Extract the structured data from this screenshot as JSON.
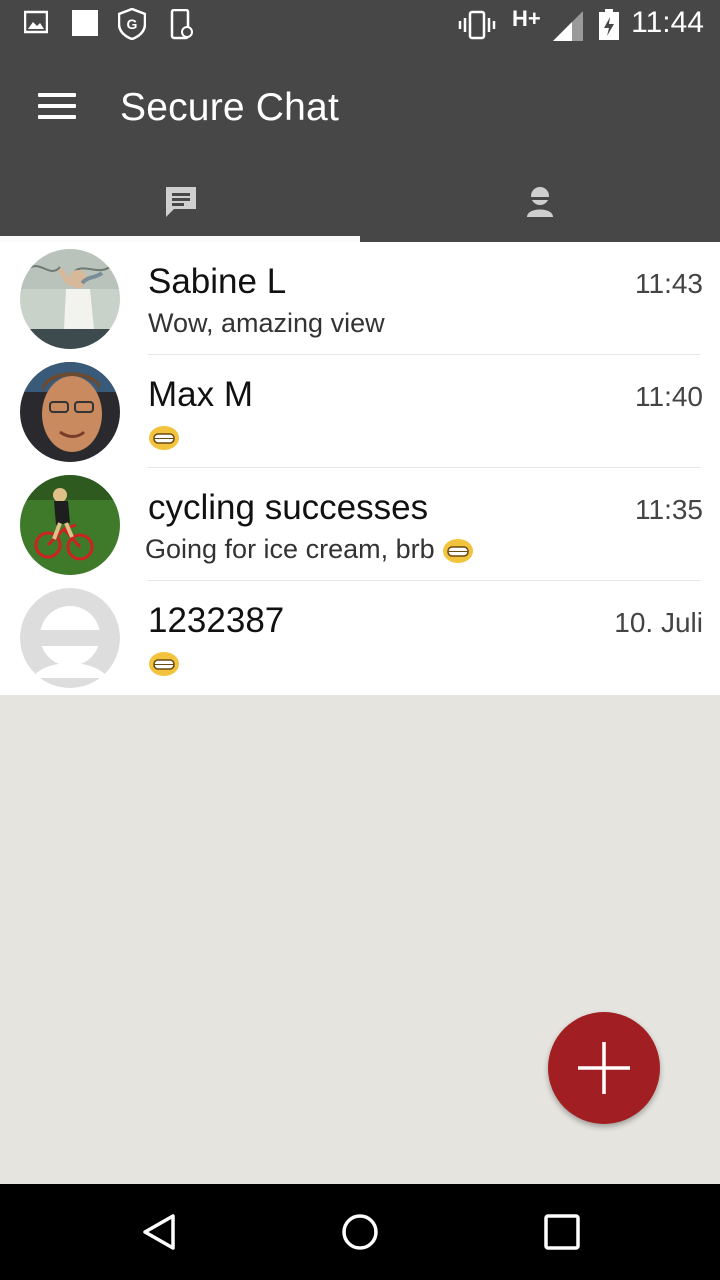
{
  "status_bar": {
    "time": "11:44",
    "network": "H+",
    "icons": [
      "image-icon",
      "square-icon",
      "shield-g-icon",
      "phone-lock-icon",
      "vibrate-icon",
      "signal-icon",
      "battery-icon"
    ]
  },
  "app_bar": {
    "title": "Secure Chat",
    "menu_icon": "hamburger-icon"
  },
  "tabs": [
    {
      "icon": "chat-icon",
      "selected": true
    },
    {
      "icon": "contact-icon",
      "selected": false
    }
  ],
  "chats": [
    {
      "name": "Sabine L",
      "time": "11:43",
      "message": "Wow, amazing view",
      "emoji": false
    },
    {
      "name": "Max M",
      "time": "11:40",
      "message": "",
      "emoji": true
    },
    {
      "name": "cycling successes",
      "time": "11:35",
      "message": "Going for ice cream, brb",
      "emoji": true
    },
    {
      "name": "1232387",
      "time": "10. Juli",
      "message": "",
      "emoji": true
    }
  ],
  "fab": {
    "icon": "plus-icon"
  },
  "nav": {
    "back": "back-icon",
    "home": "home-icon",
    "recents": "recents-icon"
  },
  "colors": {
    "bar": "#474747",
    "accent": "#a11f22",
    "background": "#e6e4df"
  }
}
